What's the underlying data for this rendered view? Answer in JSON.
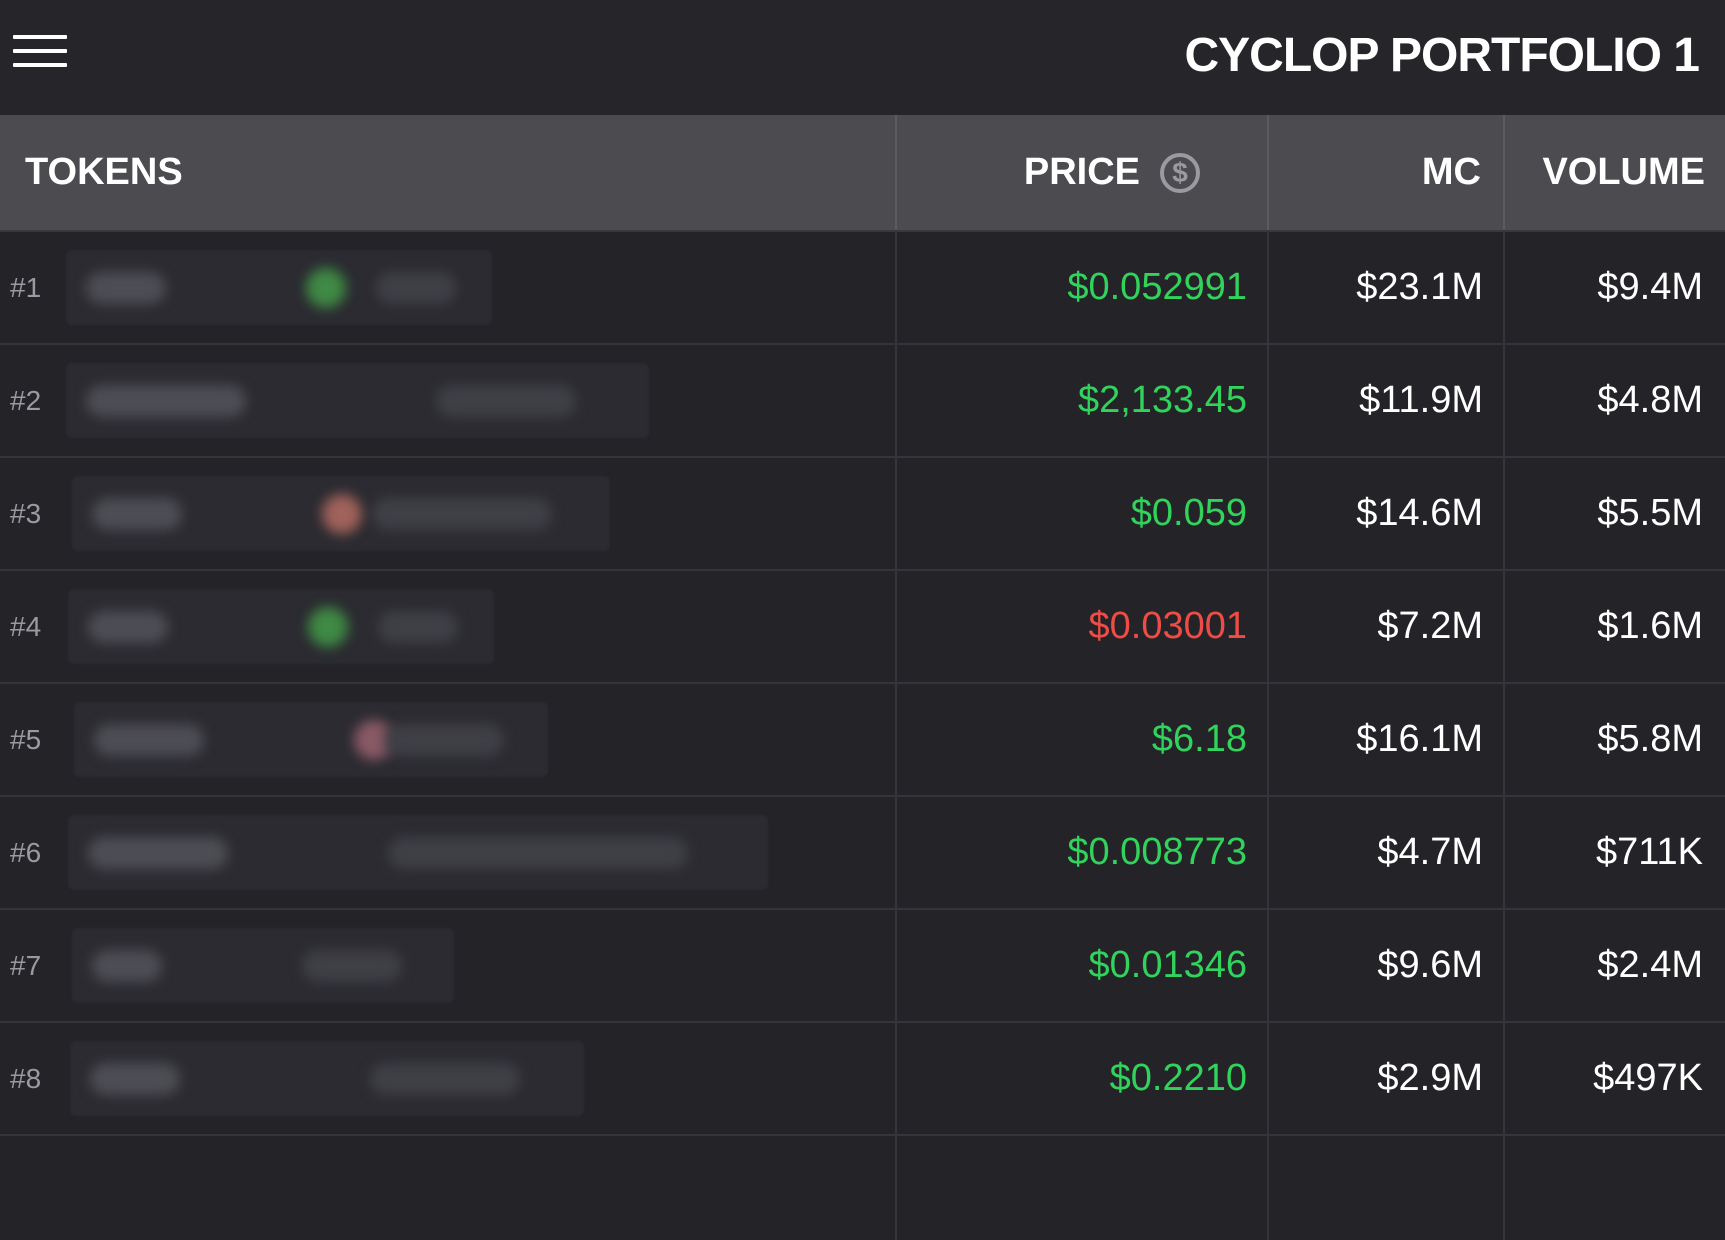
{
  "header": {
    "title": "CYCLOP PORTFOLIO 1",
    "menu_icon": "hamburger-menu-icon"
  },
  "table": {
    "columns": {
      "tokens": "TOKENS",
      "price": "PRICE",
      "mc": "MC",
      "volume": "VOLUME"
    },
    "currency_icon": "$",
    "rows": [
      {
        "rank": "#1",
        "price": "$0.052991",
        "direction": "up",
        "mc": "$23.1M",
        "volume": "$9.4M"
      },
      {
        "rank": "#2",
        "price": "$2,133.45",
        "direction": "up",
        "mc": "$11.9M",
        "volume": "$4.8M"
      },
      {
        "rank": "#3",
        "price": "$0.059",
        "direction": "up",
        "mc": "$14.6M",
        "volume": "$5.5M"
      },
      {
        "rank": "#4",
        "price": "$0.03001",
        "direction": "down",
        "mc": "$7.2M",
        "volume": "$1.6M"
      },
      {
        "rank": "#5",
        "price": "$6.18",
        "direction": "up",
        "mc": "$16.1M",
        "volume": "$5.8M"
      },
      {
        "rank": "#6",
        "price": "$0.008773",
        "direction": "up",
        "mc": "$4.7M",
        "volume": "$711K"
      },
      {
        "rank": "#7",
        "price": "$0.01346",
        "direction": "up",
        "mc": "$9.6M",
        "volume": "$2.4M"
      },
      {
        "rank": "#8",
        "price": "$0.2210",
        "direction": "up",
        "mc": "$2.9M",
        "volume": "$497K"
      }
    ]
  },
  "colors": {
    "price_up": "#31d35c",
    "price_down": "#ef4c47",
    "background": "#232328",
    "header_row": "#4b4b50"
  }
}
